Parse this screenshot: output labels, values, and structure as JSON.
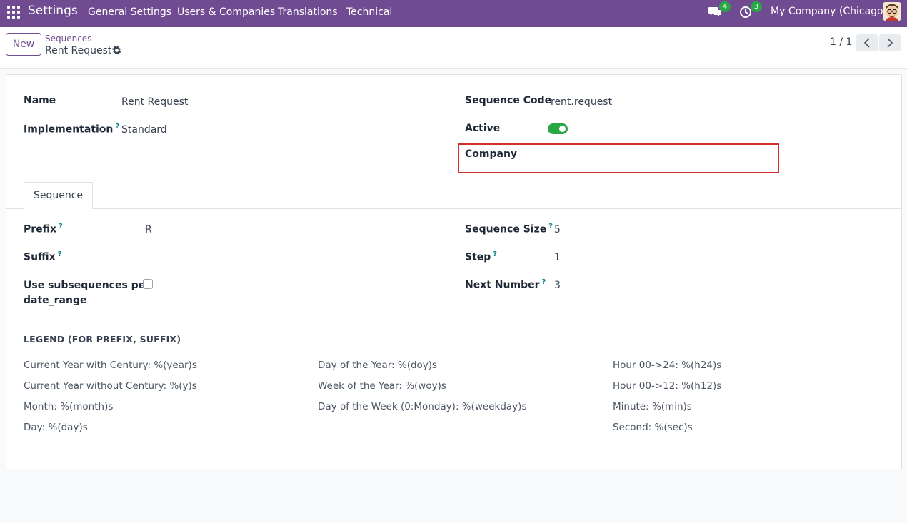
{
  "navbar": {
    "brand": "Settings",
    "menus": [
      "General Settings",
      "Users & Companies",
      "Translations",
      "Technical"
    ],
    "messages_badge": "4",
    "activities_badge": "3",
    "company": "My Company (Chicago)"
  },
  "control_panel": {
    "new_label": "New",
    "breadcrumb_parent": "Sequences",
    "breadcrumb_current": "Rent Request",
    "pager": "1 / 1"
  },
  "form": {
    "name_label": "Name",
    "name_value": "Rent Request",
    "implementation_label": "Implementation",
    "implementation_value": "Standard",
    "sequence_code_label": "Sequence Code",
    "sequence_code_value": "rent.request",
    "active_label": "Active",
    "company_label": "Company",
    "help_mark": "?"
  },
  "tabs": [
    "Sequence"
  ],
  "sequence_tab": {
    "prefix_label": "Prefix",
    "prefix_value": "R",
    "suffix_label": "Suffix",
    "subseq_label_1": "Use subsequences per",
    "subseq_label_2": "date_range",
    "size_label": "Sequence Size",
    "size_value": "5",
    "step_label": "Step",
    "step_value": "1",
    "next_label": "Next Number",
    "next_value": "3"
  },
  "legend": {
    "title": "LEGEND (FOR PREFIX, SUFFIX)",
    "col1": [
      "Current Year with Century: %(year)s",
      "Current Year without Century: %(y)s",
      "Month: %(month)s",
      "Day: %(day)s"
    ],
    "col2": [
      "Day of the Year: %(doy)s",
      "Week of the Year: %(woy)s",
      "Day of the Week (0:Monday): %(weekday)s"
    ],
    "col3": [
      "Hour 00->24: %(h24)s",
      "Hour 00->12: %(h12)s",
      "Minute: %(min)s",
      "Second: %(sec)s"
    ]
  },
  "colors": {
    "navbar": "#714b92",
    "toggle_on": "#28a745",
    "highlight_border": "#d32f2f"
  }
}
